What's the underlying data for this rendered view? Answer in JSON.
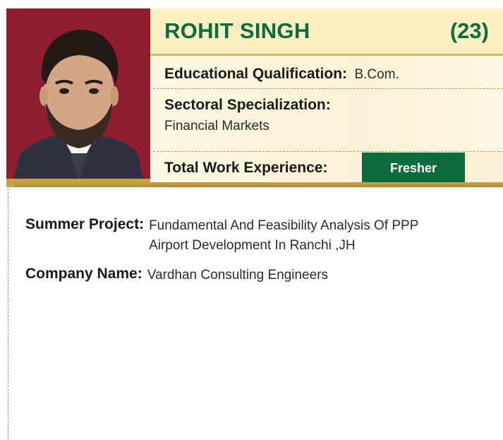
{
  "profile": {
    "name": "ROHIT SINGH",
    "age": "(23)",
    "education_label": "Educational Qualification:",
    "education_value": "B.Com.",
    "specialization_label": "Sectoral Specialization:",
    "specialization_value": "Financial Markets",
    "experience_label": "Total Work Experience:",
    "experience_value": "Fresher"
  },
  "project": {
    "summer_label": "Summer Project:",
    "summer_value": "Fundamental And Feasibility Analysis Of PPP Airport Development In Ranchi ,JH",
    "company_label": "Company Name:",
    "company_value": "Vardhan Consulting Engineers"
  },
  "colors": {
    "brand_green": "#0e6b3f",
    "photo_background": "#8e1e2f",
    "gold_accent": "#c9a244",
    "cream": "#fbeec0"
  }
}
